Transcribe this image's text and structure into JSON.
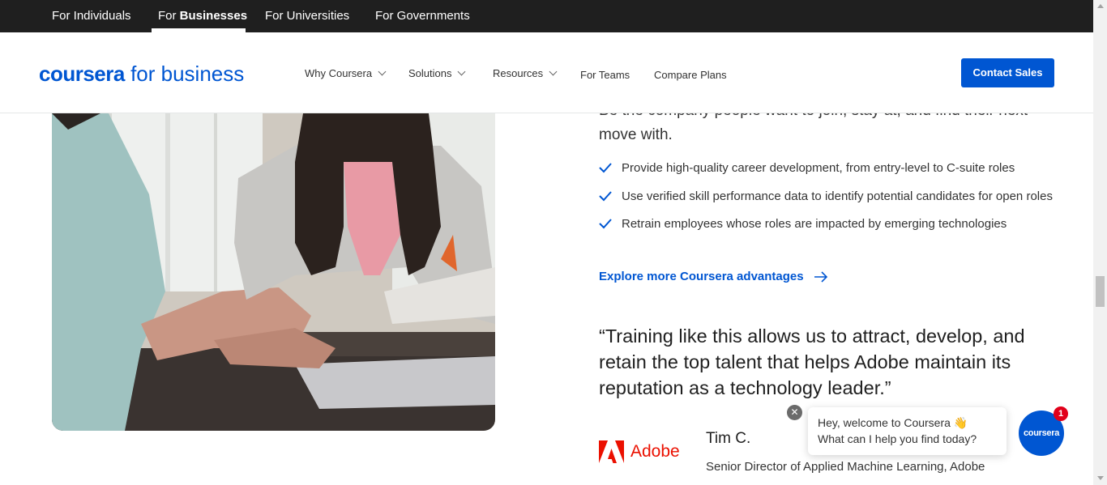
{
  "audience_tabs": [
    {
      "label": "For Individuals"
    },
    {
      "prefix": "For ",
      "label_bold": "Businesses"
    },
    {
      "label": "For Universities"
    },
    {
      "label": "For Governments"
    }
  ],
  "header": {
    "logo_brand": "coursera",
    "logo_suffix": " for business",
    "nav": [
      {
        "label": "Why Coursera"
      },
      {
        "label": "Solutions"
      },
      {
        "label": "Resources"
      },
      {
        "label": "For Teams"
      },
      {
        "label": "Compare Plans"
      }
    ],
    "contact_label": "Contact Sales"
  },
  "content": {
    "intro": "Be the company people want to join, stay at, and find their next move with.",
    "checklist": [
      "Provide high-quality career development, from entry-level to C-suite roles",
      "Use verified skill performance data to identify potential candidates for open roles",
      "Retrain employees whose roles are impacted by emerging technologies"
    ],
    "explore_link": "Explore more Coursera advantages",
    "quote": "“Training like this allows us to attract, develop, and retain the top talent that helps Adobe maintain its reputation as a technology leader.”",
    "company": "Adobe",
    "person_name": "Tim C.",
    "person_title": "Senior Director of Applied Machine Learning, Adobe"
  },
  "chat": {
    "line1": "Hey, welcome to Coursera 👋",
    "line2": "What can I help you find today?",
    "close_glyph": "✕",
    "launcher_label": "coursera",
    "badge_count": "1"
  },
  "colors": {
    "brand_blue": "#0056d2",
    "topbar": "#1f1f1f",
    "adobe_red": "#eb1000"
  },
  "scroll_position": 0.62
}
